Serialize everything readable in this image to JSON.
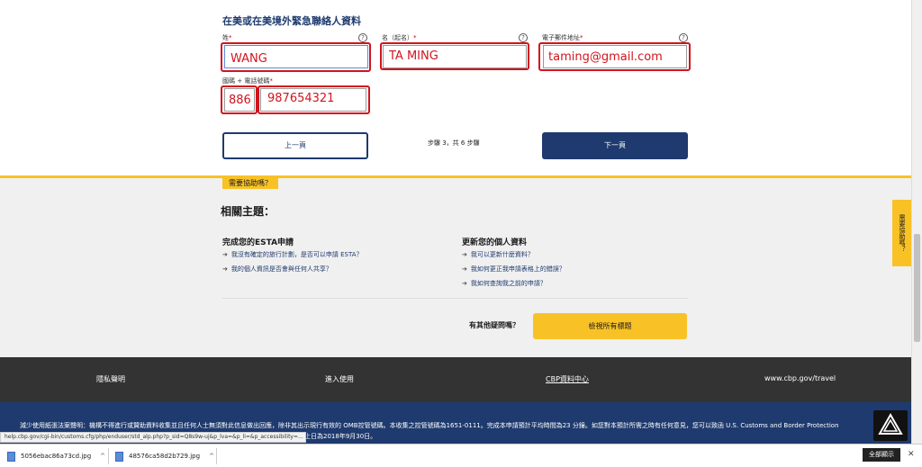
{
  "form": {
    "section_title": "在美或在美境外緊急聯絡人資料",
    "last_name_label": "姓",
    "first_name_label": "名（起名）",
    "email_label": "電子郵件地址",
    "phone_label": "國碼 + 電話號碼",
    "required_mark": "*",
    "help_mark": "?",
    "last_name_value": "WANG",
    "first_name_value": "TA MING",
    "email_value": "taming@gmail.com",
    "country_code_value": "886",
    "phone_value": "987654321",
    "highlight_color": "#d2141e"
  },
  "nav": {
    "prev_label": "上一頁",
    "step_text": "步驟 3，共 6 步驟",
    "next_label": "下一頁"
  },
  "help": {
    "tab_label": "需要協助嗎？",
    "related_title": "相關主題：",
    "col1_title": "完成您的ESTA申請",
    "col1_links": [
      "我沒有確定的旅行計劃，是否可以申請 ESTA？",
      "我的個人資訊是否會與任何人共享？"
    ],
    "col2_title": "更新您的個人資料",
    "col2_links": [
      "我可以更新什麼資料？",
      "我如何更正我申請表格上的錯誤？",
      "我如何查詢我之前的申請？"
    ],
    "other_questions": "有其他疑問嗎？",
    "view_all_label": "檢視所有標題",
    "side_tab_label": "需要協助嗎？",
    "arrow": "➔"
  },
  "footer": {
    "privacy": "隱私聲明",
    "access": "進入使用",
    "cbp_center": "CBP資料中心",
    "cbp_url": "www.cbp.gov/travel",
    "notice": "減少使用紙張法案聲明：機構不得進行或贊助資料收集並且任何人士無須對此信息做出回應，除非其出示現行有效的 OMB控管號碼。本收集之控管號碼為1651-0111。完成本申請預計平均時間為23 分鐘。如您對本預計所需之時有任何意見，您可以致函 U.S. Customs and Border Protection",
    "notice_line2": "止日為2018年9月30日。",
    "status_url": "help.cbp.gov/cgi-bin/customs.cfg/php/enduser/std_alp.php?p_sid=Q8s9w-uj&p_lva=&p_li=&p_accessibility=..."
  },
  "downloads": {
    "file1": "5056ebac86a73cd.jpg",
    "file2": "48576ca58d2b729.jpg",
    "caret": "^",
    "show_all": "全部顯示",
    "close": "✕"
  }
}
